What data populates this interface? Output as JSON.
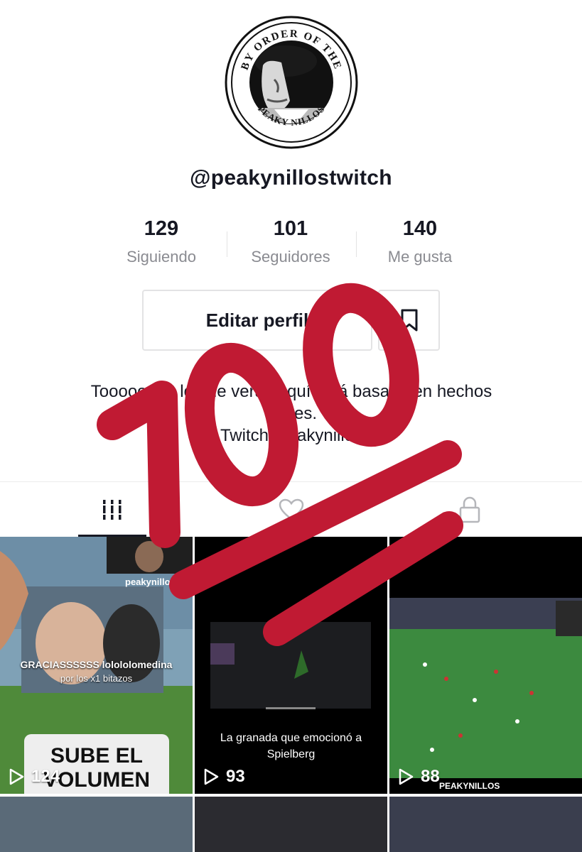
{
  "profile": {
    "logo_text_top": "BY ORDER OF THE",
    "logo_text_bottom": "PEAKY NILLOS",
    "handle": "@peakynillostwitch"
  },
  "stats": [
    {
      "value": "129",
      "label": "Siguiendo"
    },
    {
      "value": "101",
      "label": "Seguidores"
    },
    {
      "value": "140",
      "label": "Me gusta"
    }
  ],
  "buttons": {
    "edit_profile": "Editar perfil",
    "bookmark_icon": "bookmark-icon"
  },
  "bio": {
    "line1": "Toooooodo lo que verás aquí está basado en hechos",
    "line2": "reales.",
    "line3": "Twitch: peakynillos"
  },
  "tabs": [
    {
      "icon": "grid-icon",
      "active": true
    },
    {
      "icon": "heart-icon",
      "active": false
    },
    {
      "icon": "lock-icon",
      "active": false
    }
  ],
  "videos": [
    {
      "views": "124",
      "caption_top": "GRACIASSSSSS lolololomedina",
      "caption_sub": "por los x1 bitazos",
      "badge": "peakynillos",
      "big_text_1": "SUBE EL",
      "big_text_2": "VOLUMEN"
    },
    {
      "views": "93",
      "caption": "La granada que emocionó a Spielberg"
    },
    {
      "views": "88",
      "badge": "PEAKYNILLOS"
    }
  ],
  "sticker": {
    "emoji_name": "hundred-points-emoji",
    "text": "100",
    "color": "#c8102e"
  }
}
